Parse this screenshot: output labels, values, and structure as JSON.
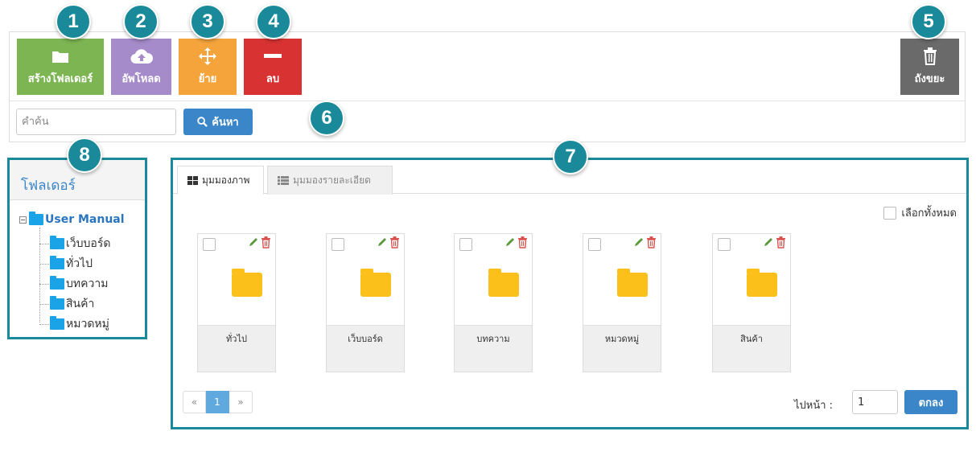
{
  "toolbar": {
    "create_folder_label": "สร้างโฟลเดอร์",
    "upload_label": "อัพโหลด",
    "move_label": "ย้าย",
    "delete_label": "ลบ",
    "trash_label": "ถังขยะ"
  },
  "search": {
    "placeholder": "คำค้น",
    "button_label": "ค้นหา"
  },
  "markers": [
    "1",
    "2",
    "3",
    "4",
    "5",
    "6",
    "7",
    "8"
  ],
  "sidebar": {
    "title": "โฟลเดอร์",
    "root": "User Manual",
    "items": [
      "เว็บบอร์ด",
      "ทั่วไป",
      "บทความ",
      "สินค้า",
      "หมวดหมู่"
    ]
  },
  "main": {
    "tabs": [
      {
        "label": "มุมมองภาพ",
        "active": true
      },
      {
        "label": "มุมมองรายละเอียด",
        "active": false
      }
    ],
    "select_all_label": "เลือกทั้งหมด",
    "folders": [
      "ทั่วไป",
      "เว็บบอร์ด",
      "บทความ",
      "หมวดหมู่",
      "สินค้า"
    ],
    "pagination": {
      "prev": "«",
      "current": "1",
      "next": "»"
    },
    "goto_label": "ไปหน้า :",
    "goto_value": "1",
    "goto_button": "ตกลง"
  },
  "colors": {
    "create": "#7cb552",
    "upload": "#a58bc9",
    "move": "#f5a43c",
    "delete": "#d93232",
    "trash": "#6a6a6a",
    "primary": "#3a86c8",
    "highlight": "#1a8a9a",
    "folder_yellow": "#fcc01a",
    "folder_blue": "#1aa3e6"
  }
}
